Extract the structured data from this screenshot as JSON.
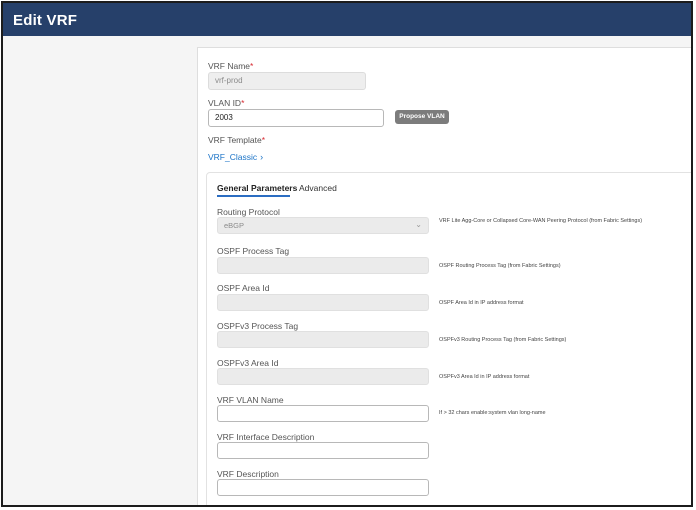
{
  "header": {
    "title": "Edit VRF"
  },
  "form": {
    "vrf_name": {
      "label": "VRF Name",
      "required": "*",
      "value": "vrf-prod"
    },
    "vlan_id": {
      "label": "VLAN ID",
      "required": "*",
      "value": "2003"
    },
    "propose_vlan_label": "Propose VLAN",
    "vrf_template": {
      "label": "VRF Template",
      "required": "*",
      "value": "VRF_Classic"
    }
  },
  "tabs": [
    {
      "label": "General Parameters",
      "active": true
    },
    {
      "label": "Advanced",
      "active": false
    }
  ],
  "fields": [
    {
      "label": "Routing Protocol",
      "value": "eBGP",
      "kind": "select",
      "disabled": true,
      "help": "VRF Lite Agg-Core or Collapsed Core-WAN Peering Protocol (from Fabric Settings)"
    },
    {
      "label": "OSPF Process Tag",
      "value": "",
      "disabled": true,
      "help": "OSPF Routing Process Tag (from Fabric Settings)"
    },
    {
      "label": "OSPF Area Id",
      "value": "",
      "disabled": true,
      "help": "OSPF Area Id in IP address format"
    },
    {
      "label": "OSPFv3 Process Tag",
      "value": "",
      "disabled": true,
      "help": "OSPFv3 Routing Process Tag (from Fabric Settings)"
    },
    {
      "label": "OSPFv3 Area Id",
      "value": "",
      "disabled": true,
      "help": "OSPFv3 Area Id in IP address format"
    },
    {
      "label": "VRF VLAN Name",
      "value": "",
      "disabled": false,
      "help": "If > 32 chars enable:system vlan long-name"
    },
    {
      "label": "VRF Interface Description",
      "value": "",
      "disabled": false,
      "help": ""
    },
    {
      "label": "VRF Description",
      "value": "",
      "disabled": false,
      "help": ""
    }
  ],
  "colors": {
    "header_bg": "#26406a",
    "link": "#1a73c7",
    "required": "#d7282f",
    "tab_underline": "#2b6dc2"
  }
}
